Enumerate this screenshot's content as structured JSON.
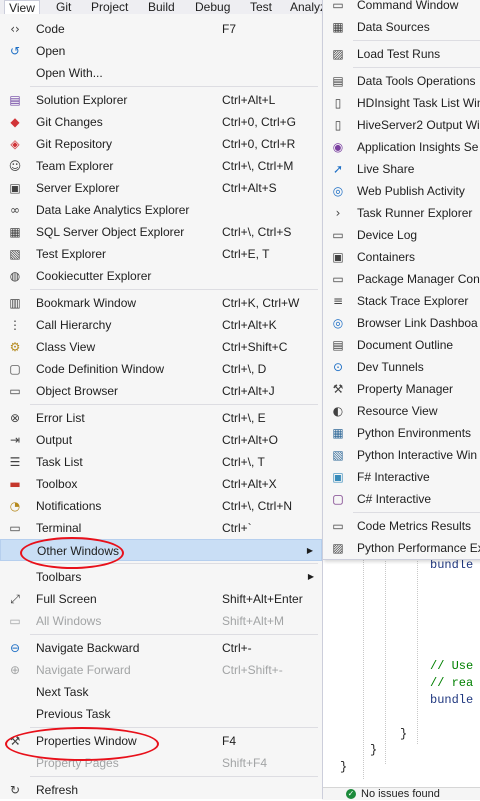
{
  "menubar": [
    "View",
    "Git",
    "Project",
    "Build",
    "Debug",
    "Test",
    "Analyz"
  ],
  "view_menu": [
    {
      "label": "Code",
      "shortcut": "F7",
      "icon": "code-icon"
    },
    {
      "label": "Open",
      "shortcut": "",
      "icon": "open-icon"
    },
    {
      "label": "Open With...",
      "shortcut": "",
      "icon": ""
    },
    {
      "sep": true
    },
    {
      "label": "Solution Explorer",
      "shortcut": "Ctrl+Alt+L",
      "icon": "solution-explorer-icon"
    },
    {
      "label": "Git Changes",
      "shortcut": "Ctrl+0, Ctrl+G",
      "icon": "git-changes-icon"
    },
    {
      "label": "Git Repository",
      "shortcut": "Ctrl+0, Ctrl+R",
      "icon": "git-repository-icon"
    },
    {
      "label": "Team Explorer",
      "shortcut": "Ctrl+\\, Ctrl+M",
      "icon": "team-explorer-icon"
    },
    {
      "label": "Server Explorer",
      "shortcut": "Ctrl+Alt+S",
      "icon": "server-explorer-icon"
    },
    {
      "label": "Data Lake Analytics Explorer",
      "shortcut": "",
      "icon": "data-lake-icon"
    },
    {
      "label": "SQL Server Object Explorer",
      "shortcut": "Ctrl+\\, Ctrl+S",
      "icon": "sql-server-icon"
    },
    {
      "label": "Test Explorer",
      "shortcut": "Ctrl+E, T",
      "icon": "test-explorer-icon"
    },
    {
      "label": "Cookiecutter Explorer",
      "shortcut": "",
      "icon": "cookiecutter-icon"
    },
    {
      "sep": true
    },
    {
      "label": "Bookmark Window",
      "shortcut": "Ctrl+K, Ctrl+W",
      "icon": "bookmark-icon"
    },
    {
      "label": "Call Hierarchy",
      "shortcut": "Ctrl+Alt+K",
      "icon": "call-hierarchy-icon"
    },
    {
      "label": "Class View",
      "shortcut": "Ctrl+Shift+C",
      "icon": "class-view-icon"
    },
    {
      "label": "Code Definition Window",
      "shortcut": "Ctrl+\\, D",
      "icon": "code-definition-icon"
    },
    {
      "label": "Object Browser",
      "shortcut": "Ctrl+Alt+J",
      "icon": "object-browser-icon"
    },
    {
      "sep": true
    },
    {
      "label": "Error List",
      "shortcut": "Ctrl+\\, E",
      "icon": "error-list-icon"
    },
    {
      "label": "Output",
      "shortcut": "Ctrl+Alt+O",
      "icon": "output-icon"
    },
    {
      "label": "Task List",
      "shortcut": "Ctrl+\\, T",
      "icon": "task-list-icon"
    },
    {
      "label": "Toolbox",
      "shortcut": "Ctrl+Alt+X",
      "icon": "toolbox-icon"
    },
    {
      "label": "Notifications",
      "shortcut": "Ctrl+\\, Ctrl+N",
      "icon": "notifications-icon"
    },
    {
      "label": "Terminal",
      "shortcut": "Ctrl+`",
      "icon": "terminal-icon"
    },
    {
      "label": "Other Windows",
      "shortcut": "",
      "icon": "",
      "submenu": true,
      "highlighted": true
    },
    {
      "sep": true
    },
    {
      "label": "Toolbars",
      "shortcut": "",
      "icon": "",
      "submenu": true
    },
    {
      "label": "Full Screen",
      "shortcut": "Shift+Alt+Enter",
      "icon": "full-screen-icon"
    },
    {
      "label": "All Windows",
      "shortcut": "Shift+Alt+M",
      "icon": "all-windows-icon",
      "disabled": true
    },
    {
      "sep": true
    },
    {
      "label": "Navigate Backward",
      "shortcut": "Ctrl+-",
      "icon": "navigate-backward-icon"
    },
    {
      "label": "Navigate Forward",
      "shortcut": "Ctrl+Shift+-",
      "icon": "navigate-forward-icon",
      "disabled": true
    },
    {
      "label": "Next Task",
      "shortcut": "",
      "icon": ""
    },
    {
      "label": "Previous Task",
      "shortcut": "",
      "icon": ""
    },
    {
      "sep": true
    },
    {
      "label": "Properties Window",
      "shortcut": "F4",
      "icon": "wrench-icon"
    },
    {
      "label": "Property Pages",
      "shortcut": "Shift+F4",
      "icon": "",
      "disabled": true
    },
    {
      "sep": true
    },
    {
      "label": "Refresh",
      "shortcut": "",
      "icon": "refresh-icon"
    }
  ],
  "other_windows": [
    {
      "label": "Command Window",
      "icon": "command-window-icon"
    },
    {
      "label": "Data Sources",
      "icon": "data-sources-icon"
    },
    {
      "sep": true
    },
    {
      "label": "Load Test Runs",
      "icon": "load-test-icon"
    },
    {
      "sep": true
    },
    {
      "label": "Data Tools Operations",
      "icon": "data-tools-icon"
    },
    {
      "label": "HDInsight Task List Win",
      "icon": "hdinsight-icon"
    },
    {
      "label": "HiveServer2 Output Wi",
      "icon": "hiveserver-icon"
    },
    {
      "label": "Application Insights Se",
      "icon": "app-insights-icon"
    },
    {
      "label": "Live Share",
      "icon": "live-share-icon"
    },
    {
      "label": "Web Publish Activity",
      "icon": "web-publish-icon"
    },
    {
      "label": "Task Runner Explorer",
      "icon": "task-runner-icon"
    },
    {
      "label": "Device Log",
      "icon": "device-log-icon"
    },
    {
      "label": "Containers",
      "icon": "containers-icon"
    },
    {
      "label": "Package Manager Con",
      "icon": "package-manager-icon"
    },
    {
      "label": "Stack Trace Explorer",
      "icon": "stack-trace-icon"
    },
    {
      "label": "Browser Link Dashboa",
      "icon": "browser-link-icon"
    },
    {
      "label": "Document Outline",
      "icon": "document-outline-icon"
    },
    {
      "label": "Dev Tunnels",
      "icon": "dev-tunnels-icon"
    },
    {
      "label": "Property Manager",
      "icon": "property-manager-icon"
    },
    {
      "label": "Resource View",
      "icon": "resource-view-icon"
    },
    {
      "label": "Python Environments",
      "icon": "python-env-icon"
    },
    {
      "label": "Python Interactive Win",
      "icon": "python-interactive-icon"
    },
    {
      "label": "F# Interactive",
      "icon": "fsharp-icon"
    },
    {
      "label": "C# Interactive",
      "icon": "csharp-icon"
    },
    {
      "sep": true
    },
    {
      "label": "Code Metrics Results",
      "icon": "code-metrics-icon"
    },
    {
      "label": "Python Performance Ex",
      "icon": "python-perf-icon"
    }
  ],
  "code_lines": [
    "bundle",
    "// Use",
    "// rea",
    "bundle",
    "}",
    "}",
    "}"
  ],
  "status": {
    "text": "No issues found"
  },
  "colors": {
    "highlight": "#c9def5",
    "annotation": "#e8101a",
    "menu_bg": "#f6f6f6"
  }
}
